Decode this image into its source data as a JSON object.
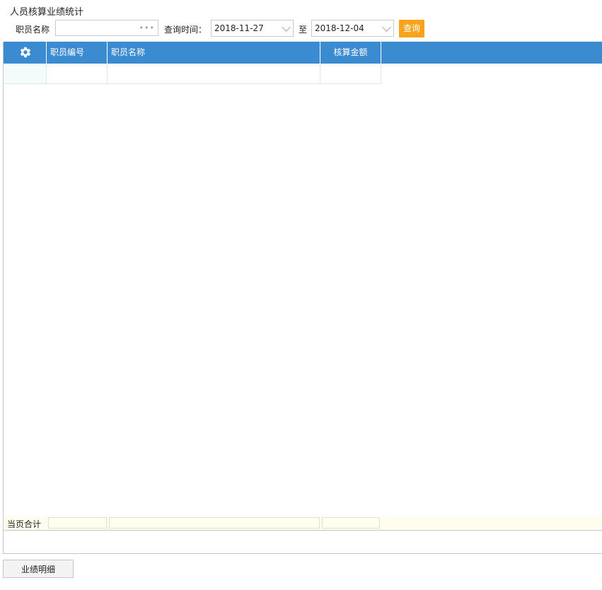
{
  "page": {
    "title": "人员核算业绩统计"
  },
  "filters": {
    "employee_name_label": "职员名称",
    "employee_name_value": "",
    "employee_name_placeholder": "",
    "query_time_label": "查询时间：",
    "start_date": "2018-11-27",
    "to_label": "至",
    "end_date": "2018-12-04",
    "query_button": "查询"
  },
  "table": {
    "settings_icon": "gear-icon",
    "columns": [
      "职员编号",
      "职员名称",
      "核算金额"
    ],
    "rows": [
      [
        "",
        "",
        ""
      ]
    ],
    "footer_label": "当页合计"
  },
  "actions": {
    "detail_button": "业绩明细"
  },
  "colors": {
    "header_bg": "#3b8bd0",
    "query_button_bg": "#f7a31c",
    "footer_bg": "#fffdf0"
  }
}
